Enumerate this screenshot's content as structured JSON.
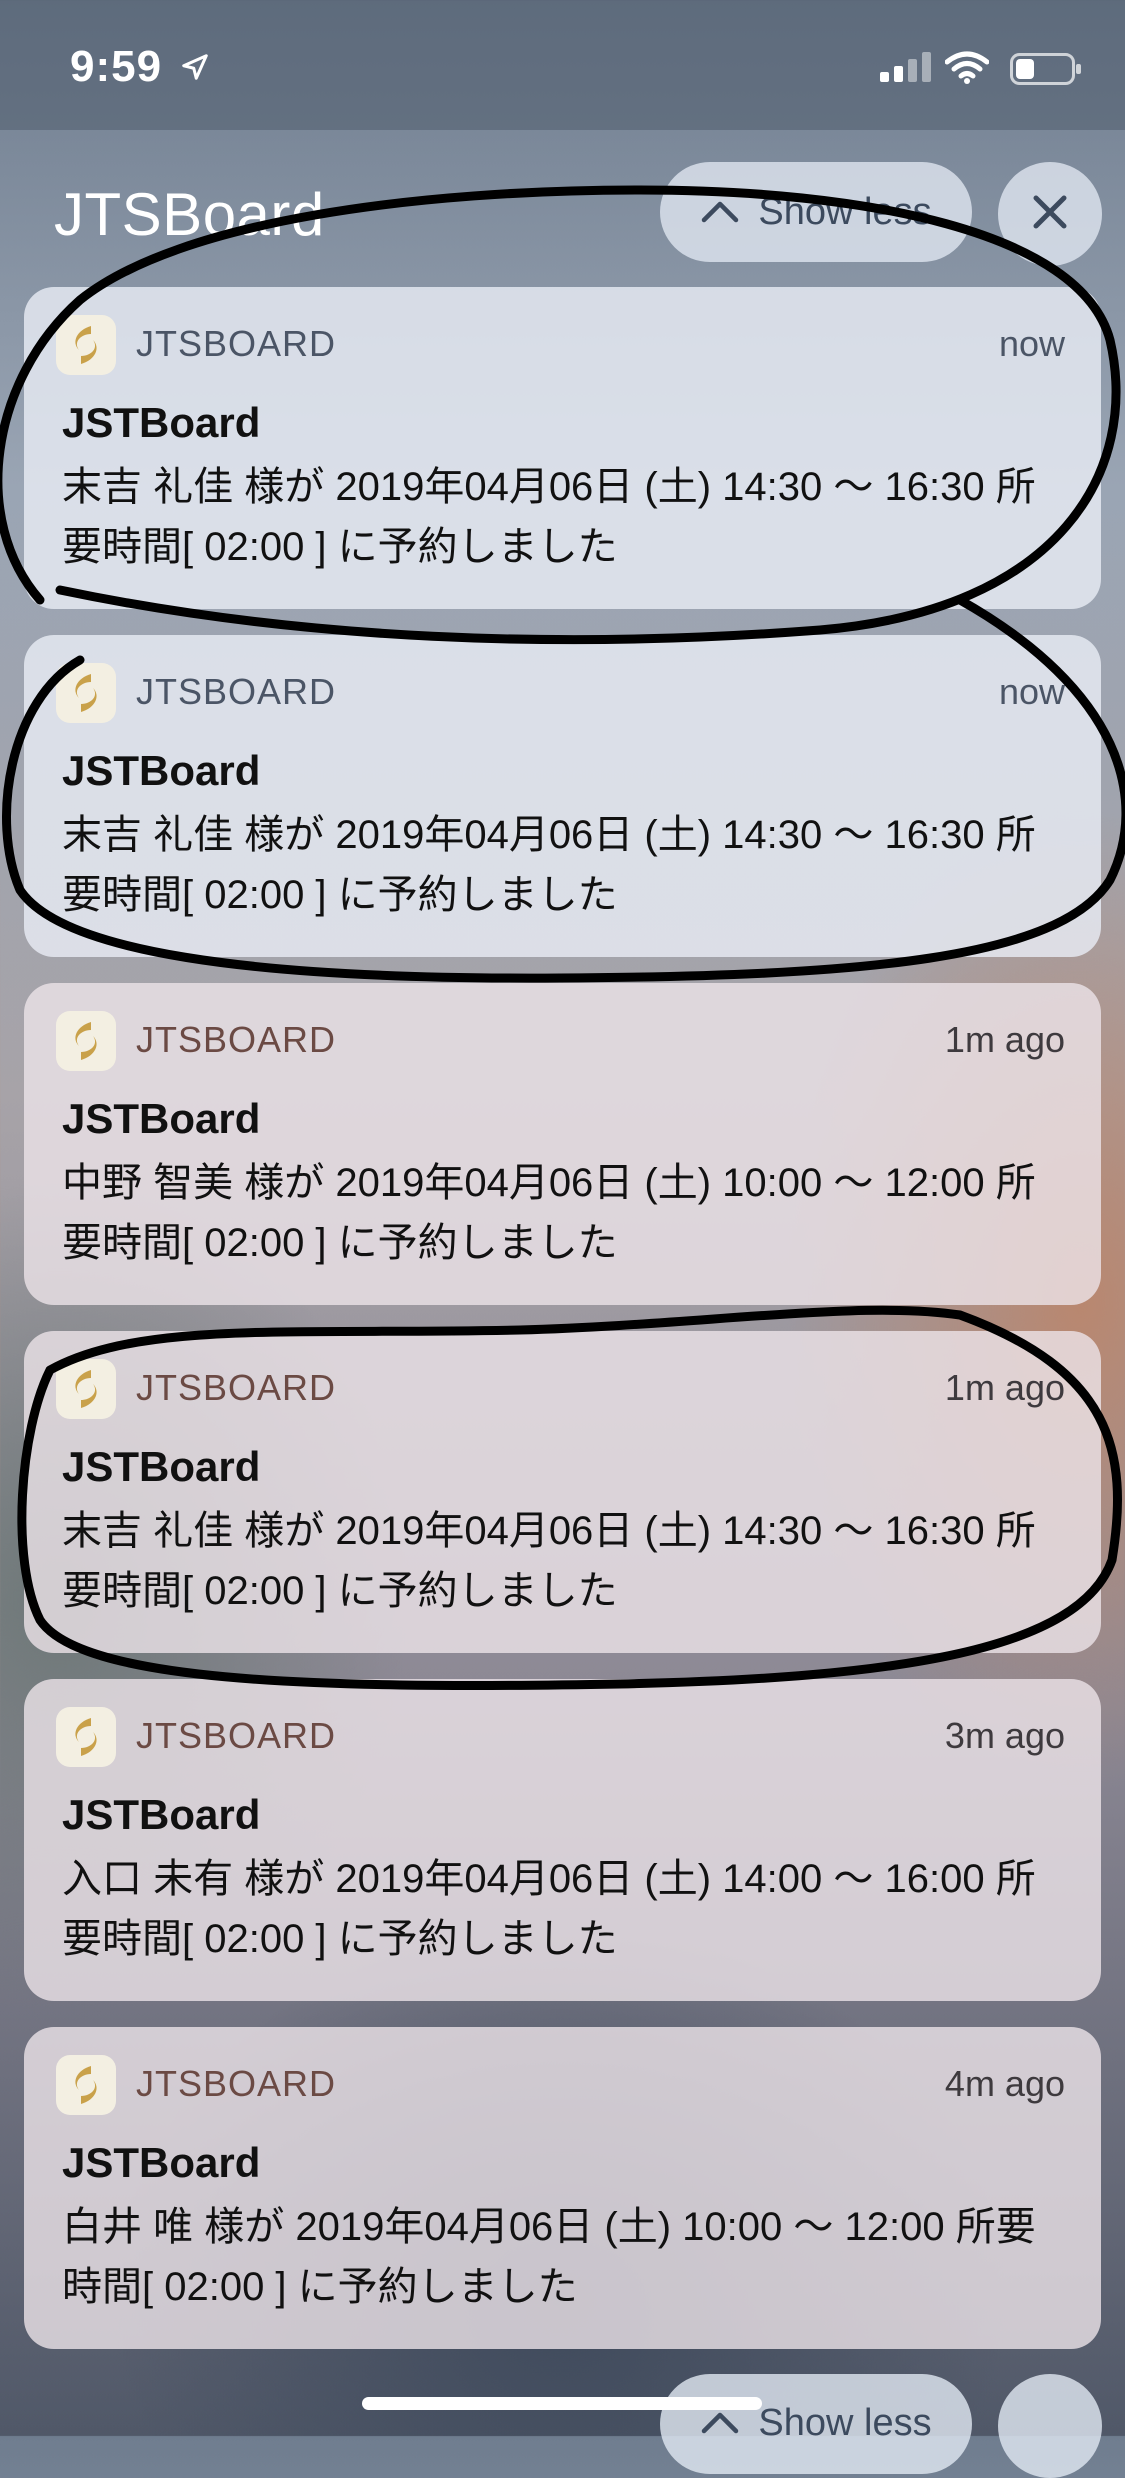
{
  "status_bar": {
    "time": "9:59"
  },
  "group": {
    "title": "JTSBoard",
    "show_less_label": "Show less"
  },
  "notifications": [
    {
      "app": "JTSBOARD",
      "time": "now",
      "title": "JSTBoard",
      "body": "末吉 礼佳 様が 2019年04月06日 (土) 14:30 〜 16:30 所要時間[ 02:00 ] に予約しました"
    },
    {
      "app": "JTSBOARD",
      "time": "now",
      "title": "JSTBoard",
      "body": "末吉 礼佳 様が 2019年04月06日 (土) 14:30 〜 16:30 所要時間[ 02:00 ] に予約しました"
    },
    {
      "app": "JTSBOARD",
      "time": "1m ago",
      "title": "JSTBoard",
      "body": "中野 智美 様が 2019年04月06日 (土) 10:00 〜 12:00 所要時間[ 02:00 ] に予約しました"
    },
    {
      "app": "JTSBOARD",
      "time": "1m ago",
      "title": "JSTBoard",
      "body": "末吉 礼佳 様が 2019年04月06日 (土) 14:30 〜 16:30 所要時間[ 02:00 ] に予約しました"
    },
    {
      "app": "JTSBOARD",
      "time": "3m ago",
      "title": "JSTBoard",
      "body": "入口 未有 様が 2019年04月06日 (土) 14:00 〜 16:00 所要時間[ 02:00 ] に予約しました"
    },
    {
      "app": "JTSBOARD",
      "time": "4m ago",
      "title": "JSTBoard",
      "body": "白井 唯 様が 2019年04月06日 (土) 10:00 〜 12:00 所要時間[ 02:00 ] に予約しました"
    }
  ],
  "footer": {
    "show_less_label": "Show less"
  },
  "icons": {
    "location": "location-arrow-icon",
    "signal": "cellular-signal-icon",
    "wifi": "wifi-icon",
    "battery": "battery-icon",
    "chevron": "chevron-up-icon",
    "close": "close-icon",
    "app": "jtsboard-app-icon"
  }
}
